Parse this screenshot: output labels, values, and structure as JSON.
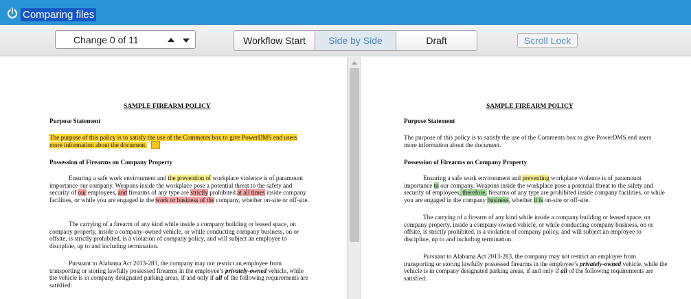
{
  "app": {
    "title": "Comparing files",
    "accent_color": "#2a95d6",
    "title_icon": "power-icon"
  },
  "toolbar": {
    "change_label": "Change 0 of 11",
    "up_icon": "triangle-up-icon",
    "down_icon": "triangle-down-icon",
    "segments": [
      {
        "label": "Workflow Start",
        "active": false
      },
      {
        "label": "Side by Side",
        "active": true
      },
      {
        "label": "Draft",
        "active": false
      }
    ],
    "scroll_lock_label": "Scroll Lock"
  },
  "left_doc": {
    "title": "SAMPLE FIREARM POLICY",
    "purpose_heading": "Purpose Statement",
    "purpose_line1": "The purpose of this policy is to satisfy the use of the Comments box to give PowerDMS end users",
    "purpose_line2": "more information about the document.",
    "possession_heading": "Possession of Firearms on Company Property",
    "p1": {
      "a": "Ensuring a safe work environment and ",
      "b": "the prevention of",
      "c": " workplace violence is of paramount importance our company.  Weapons inside the workplace pose a potential threat to the safety and security of ",
      "d": "our",
      "e": " employees, ",
      "f": "and",
      "g": " firearms of any type are ",
      "h": "strictly",
      "i": " prohibited ",
      "j": "at all times",
      "k": " inside company facilities, or while you are engaged in the ",
      "l": "work or business of the",
      "m": " company, whether on-site or off-site."
    },
    "p2": "The carrying of a firearm of any kind while inside a company building or leased space, on company property, inside a company-owned vehicle, or while conducting company business, on or offsite, is strictly prohibited, is a violation of company policy, and will subject an employee to discipline, up to and including termination.",
    "p3": {
      "a": "Pursuant to Alabama Act 2013-283, the company may not restrict an employee from transporting or storing lawfully possessed firearms in the employee’s ",
      "b": "privately-owned",
      "c": " vehicle, while the vehicle is in company designated parking areas, if and only if ",
      "d": "all",
      "e": " of the following requirements are satisfied:"
    }
  },
  "right_doc": {
    "title": "SAMPLE FIREARM POLICY",
    "purpose_heading": "Purpose Statement",
    "purpose_line1": "The purpose of this policy is to satisfy the use of the Comments box to give PowerDMS end users",
    "purpose_line2": "more information about the document.",
    "possession_heading": "Possession of Firearms on Company Property",
    "p1": {
      "a": "Ensuring a safe work environment and ",
      "b": "preventing",
      "c": " workplace violence is of paramount importance ",
      "d": "to",
      "e": " our company.  Weapons inside the workplace pose a potential threat to the safety and security of employees",
      "f": ", therefore,",
      "g": " firearms of any type are prohibited inside company facilities, or while you are engaged in the company ",
      "h": "business",
      "i": ", whether ",
      "j": "it is",
      "k": " on-site or off-site."
    },
    "p2": "The carrying of a firearm of any kind while inside a company building or leased space, on company property, inside a company-owned vehicle, or while conducting company business, on or offsite, is strictly prohibited, is a violation of company policy, and will subject an employee to discipline, up to and including termination.",
    "p3": {
      "a": "Pursuant to Alabama Act 2013-283, the company may not restrict an employee from transporting or storing lawfully possessed firearms in the employee’s ",
      "b": "privately-owned",
      "c": " vehicle, while the vehicle is in company designated parking areas, if and only if ",
      "d": "all",
      "e": " of the following requirements are satisfied:"
    }
  }
}
